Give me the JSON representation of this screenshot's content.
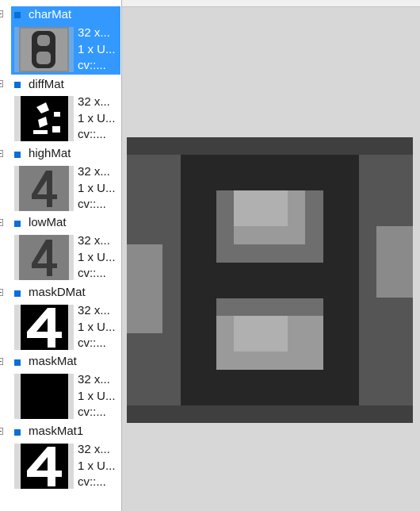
{
  "colors": {
    "selection": "#3399ff",
    "marker": "#0a6fd6",
    "background": "#d7d7d7"
  },
  "variables": [
    {
      "name": "charMat",
      "info": [
        "32 x...",
        "1 x U...",
        "cv::..."
      ],
      "selected": true,
      "thumb": "eight-blur"
    },
    {
      "name": "diffMat",
      "info": [
        "32 x...",
        "1 x U...",
        "cv::..."
      ],
      "selected": false,
      "thumb": "diff"
    },
    {
      "name": "highMat",
      "info": [
        "32 x...",
        "1 x U...",
        "cv::..."
      ],
      "selected": false,
      "thumb": "four-gray"
    },
    {
      "name": "lowMat",
      "info": [
        "32 x...",
        "1 x U...",
        "cv::..."
      ],
      "selected": false,
      "thumb": "four-gray"
    },
    {
      "name": "maskDMat",
      "info": [
        "32 x...",
        "1 x U...",
        "cv::..."
      ],
      "selected": false,
      "thumb": "four-mask"
    },
    {
      "name": "maskMat",
      "info": [
        "32 x...",
        "1 x U...",
        "cv::..."
      ],
      "selected": false,
      "thumb": "black"
    },
    {
      "name": "maskMat1",
      "info": [
        "32 x...",
        "1 x U...",
        "cv::..."
      ],
      "selected": false,
      "thumb": "four-mask"
    }
  ]
}
